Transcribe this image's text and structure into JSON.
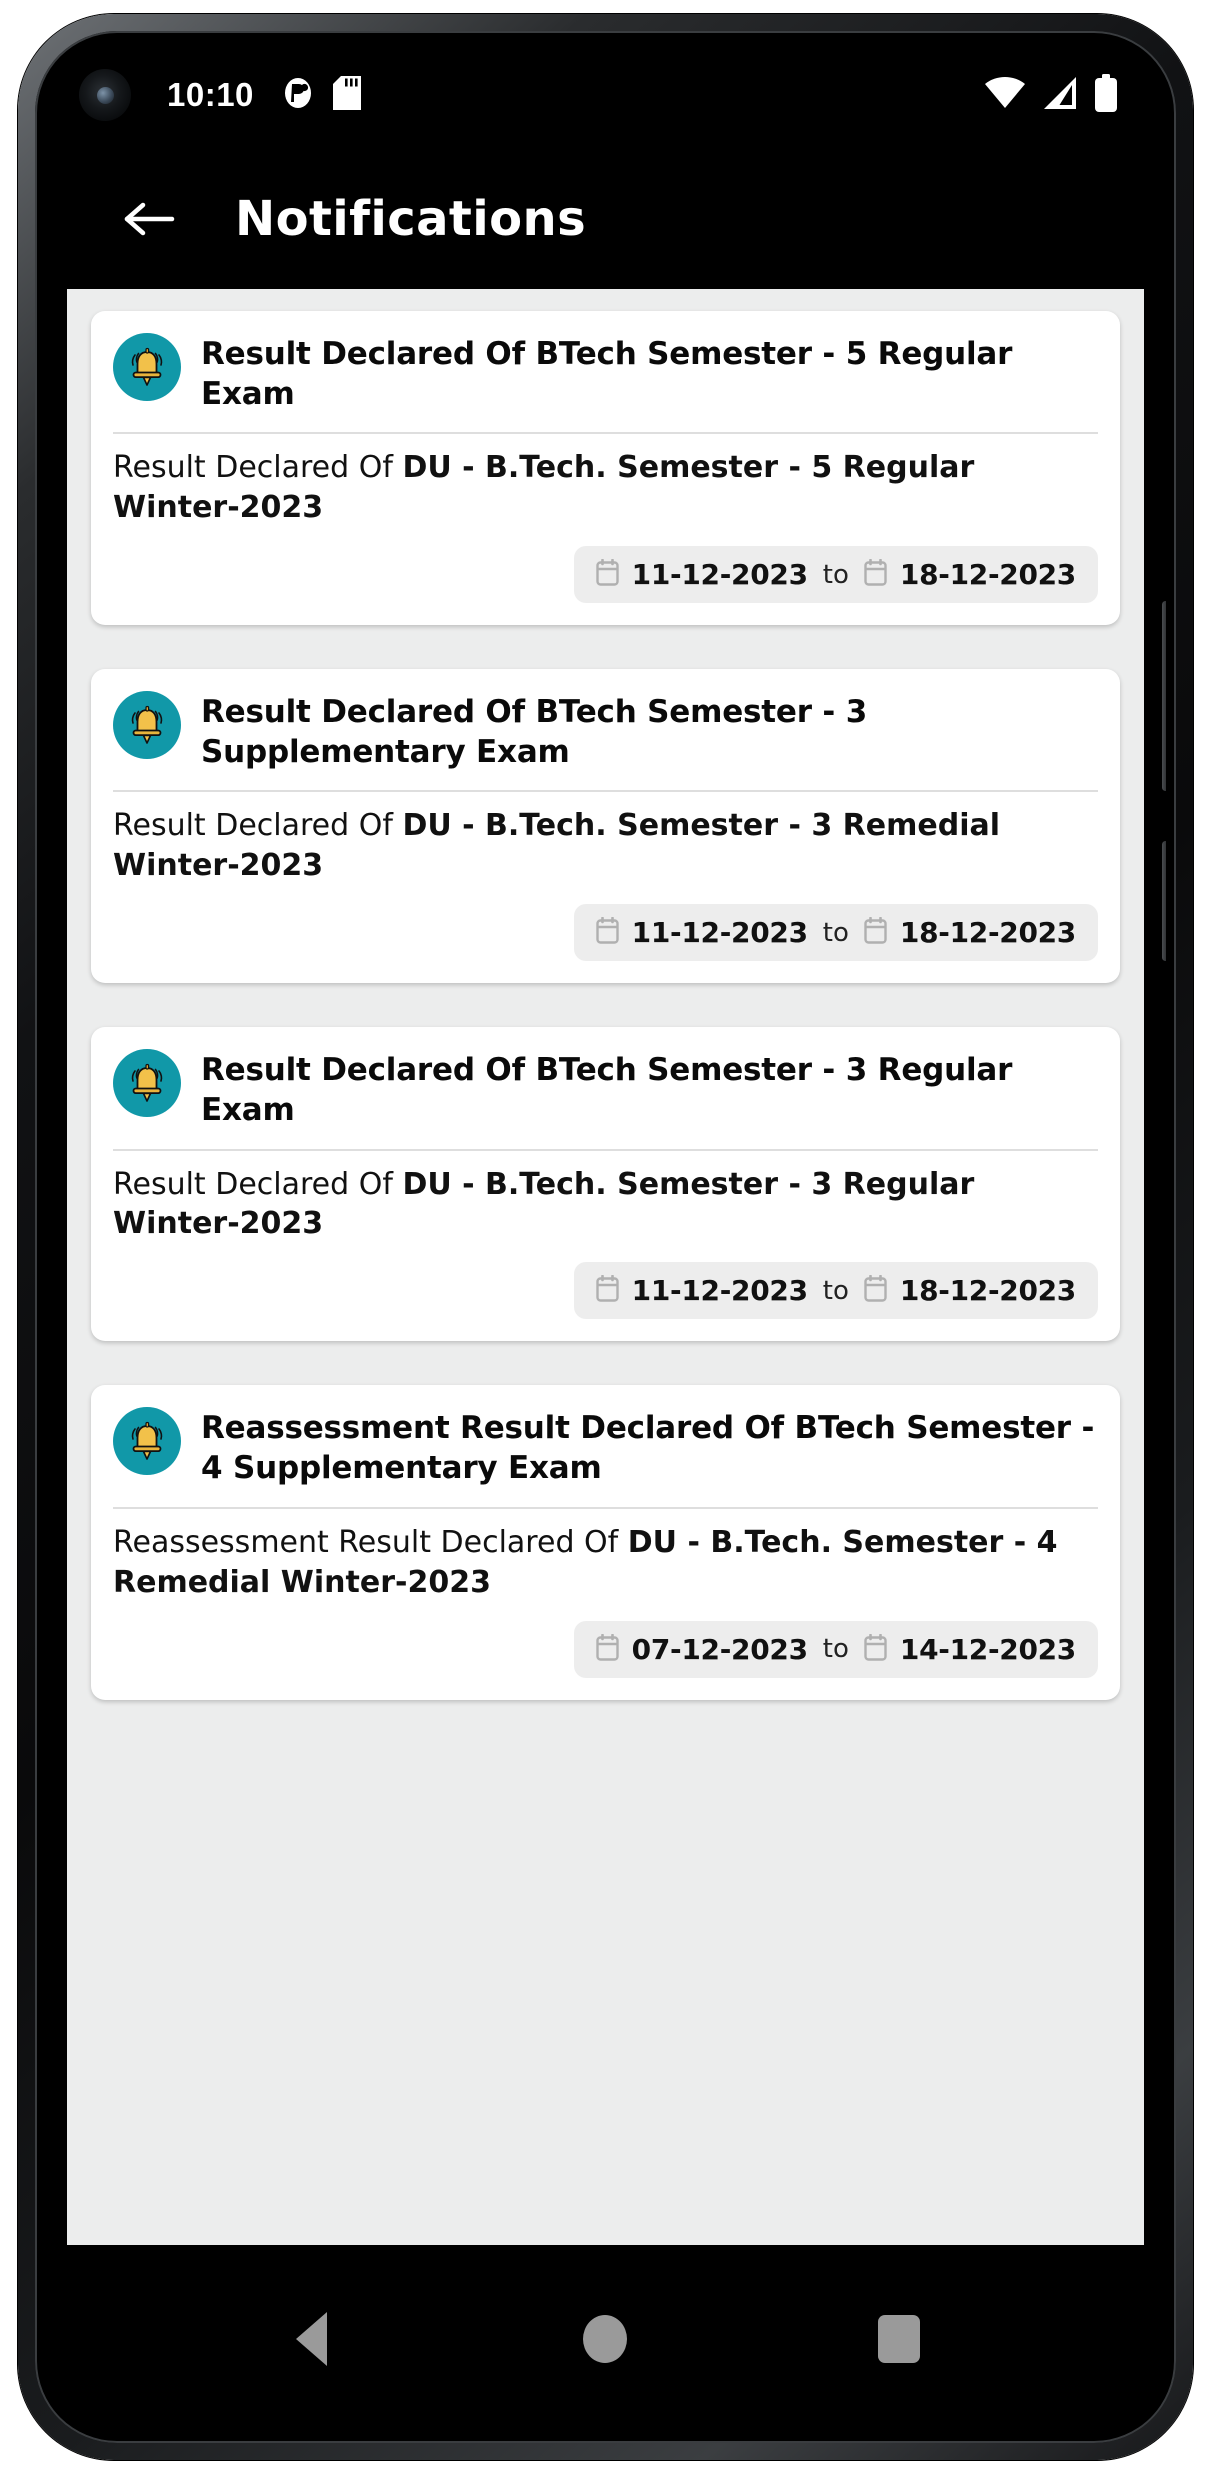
{
  "status_bar": {
    "time": "10:10",
    "left_icons": [
      "dnd-icon",
      "sd-card-icon"
    ],
    "right_icons": [
      "wifi-icon",
      "cellular-signal-icon",
      "battery-icon"
    ]
  },
  "app_bar": {
    "back_label": "back-arrow",
    "title": "Notifications"
  },
  "colors": {
    "accent_teal": "#1198a8",
    "bell_gold": "#f2c14a",
    "content_bg": "#eceded",
    "card_bg": "#ffffff",
    "pill_bg": "#ededed",
    "app_bar_bg": "#000000"
  },
  "notifications": [
    {
      "icon": "bell-icon",
      "title": "Result Declared Of BTech Semester - 5 Regular Exam",
      "body_prefix": "Result Declared Of ",
      "body_emphasis": "DU - B.Tech. Semester - 5 Regular Winter-2023",
      "start_date": "11-12-2023",
      "separator": "to",
      "end_date": "18-12-2023"
    },
    {
      "icon": "bell-icon",
      "title": "Result Declared Of BTech Semester - 3 Supplementary Exam",
      "body_prefix": "Result Declared Of ",
      "body_emphasis": "DU - B.Tech. Semester - 3 Remedial Winter-2023",
      "start_date": "11-12-2023",
      "separator": "to",
      "end_date": "18-12-2023"
    },
    {
      "icon": "bell-icon",
      "title": "Result Declared Of BTech Semester - 3 Regular Exam",
      "body_prefix": "Result Declared Of ",
      "body_emphasis": "DU - B.Tech. Semester - 3 Regular Winter-2023",
      "start_date": "11-12-2023",
      "separator": "to",
      "end_date": "18-12-2023"
    },
    {
      "icon": "bell-icon",
      "title": "Reassessment Result Declared Of BTech Semester - 4 Supplementary Exam",
      "body_prefix": "Reassessment Result Declared Of ",
      "body_emphasis": "DU - B.Tech. Semester - 4 Remedial Winter-2023",
      "start_date": "07-12-2023",
      "separator": "to",
      "end_date": "14-12-2023"
    }
  ],
  "nav_bar": {
    "back_label": "Back",
    "home_label": "Home",
    "recents_label": "Recents"
  }
}
